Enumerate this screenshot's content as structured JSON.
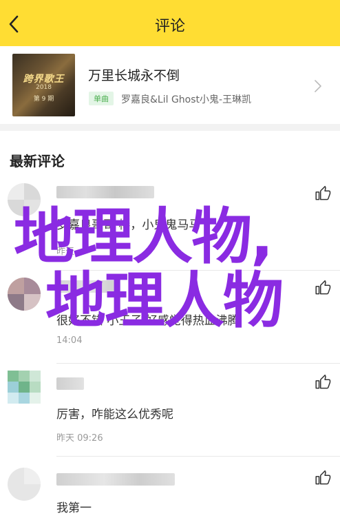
{
  "header": {
    "title": "评论"
  },
  "song": {
    "cover_title": "跨界歌王",
    "cover_year": "2018",
    "cover_episode": "第 9 期",
    "title": "万里长城永不倒",
    "badge": "单曲",
    "artist": "罗嘉良&Lil Ghost小鬼-王琳凯"
  },
  "section": {
    "latest_comments": "最新评论"
  },
  "comments": [
    {
      "text": "罗嘉良哥哥 棒，小鬼鬼马马",
      "time": "昨天 ..."
    },
    {
      "text": "很好不错 小王子 好感觉得热血沸腾",
      "time": "14:04"
    },
    {
      "text": "厉害，咋能这么优秀呢",
      "time": "昨天 09:26"
    },
    {
      "text": "我第一",
      "time": ""
    }
  ],
  "watermark": {
    "line1": "地理人物,",
    "line2": "地理人物"
  },
  "colors": {
    "header_bg": "#ffdd33",
    "badge_green": "#4caf50",
    "watermark_purple": "#8a2be2"
  },
  "icons": {
    "back": "chevron-left-icon",
    "song_link": "chevron-right-icon",
    "like": "thumbs-up-icon"
  }
}
